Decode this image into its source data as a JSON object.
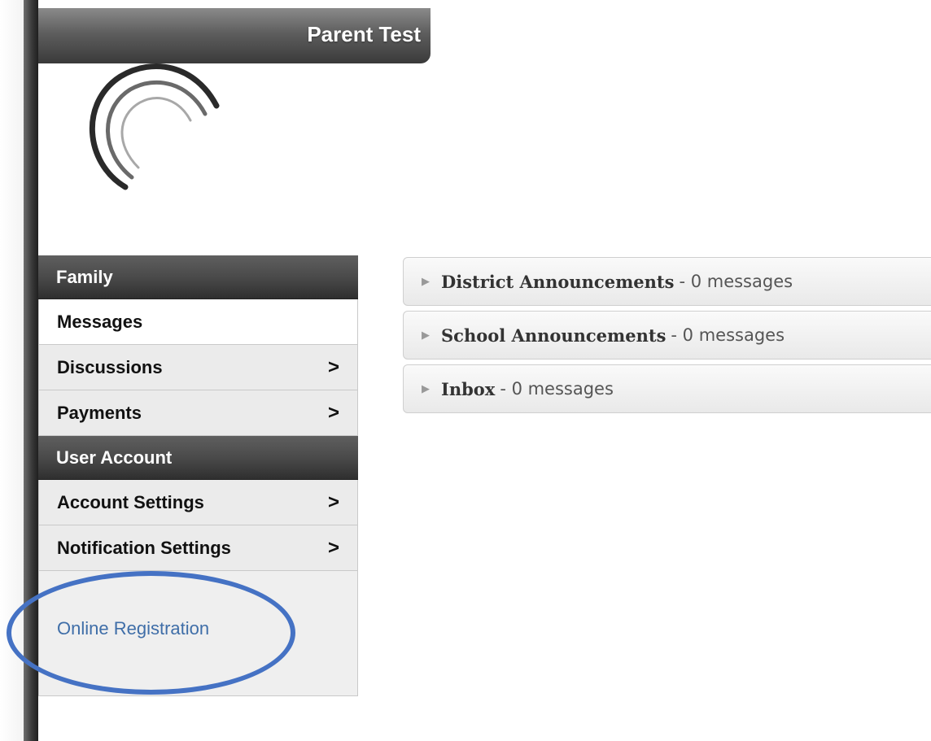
{
  "header": {
    "user_name": "Parent Test"
  },
  "sidebar": {
    "sections": [
      {
        "title": "Family",
        "items": [
          {
            "label": "Messages",
            "chevron": "",
            "active": true
          },
          {
            "label": "Discussions",
            "chevron": ">"
          },
          {
            "label": "Payments",
            "chevron": ">"
          }
        ]
      },
      {
        "title": "User Account",
        "items": [
          {
            "label": "Account Settings",
            "chevron": ">"
          },
          {
            "label": "Notification Settings",
            "chevron": ">"
          }
        ]
      }
    ],
    "links": [
      {
        "label": "Online Registration"
      }
    ]
  },
  "messages": [
    {
      "title": "District Announcements",
      "count": "- 0 messages"
    },
    {
      "title": "School Announcements",
      "count": "- 0 messages"
    },
    {
      "title": "Inbox",
      "count": "- 0 messages"
    }
  ],
  "icons": {
    "expand": "right-triangle-icon",
    "chevron": "chevron-right-icon",
    "logo": "arc-logo-icon"
  },
  "colors": {
    "link": "#3f6ea8",
    "highlight": "#4572c4"
  }
}
